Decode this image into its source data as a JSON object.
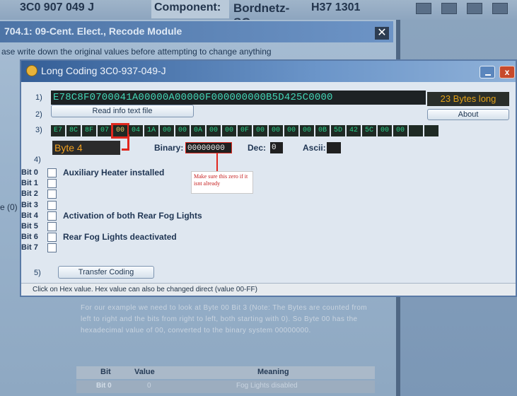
{
  "background": {
    "top_cells": [
      "3C0 907 049 J",
      "Component:",
      "Bordnetz-SG",
      "H37 1301"
    ],
    "title": "704.1: 09-Cent. Elect., Recode Module",
    "hint": "ase write down the original values before attempting to change anything",
    "side_fragment": "e (0)",
    "paragraph": "For our example we need to look at Byte 00 Bit 3 (Note: The Bytes are counted from left to right and the bits from right to left, both starting with 0). So Byte 00 has the hexadecimal value of 00, converted to the binary system 00000000.",
    "table": {
      "headers": [
        "Bit",
        "Value",
        "Meaning"
      ],
      "rows": [
        [
          "Bit 0",
          "0",
          "Fog Lights disabled"
        ]
      ]
    }
  },
  "dialog": {
    "title": "Long Coding 3C0-937-049-J",
    "row_labels": [
      "1)",
      "2)",
      "3)",
      "4)",
      "5)"
    ],
    "full_code": "E78C8F0700041A00000A00000F000000000B5D425C0000",
    "bytes_long": "23 Bytes long",
    "read_info_button": "Read info text file",
    "about_button": "About",
    "hex_bytes": [
      "E7",
      "8C",
      "8F",
      "07",
      "00",
      "04",
      "1A",
      "00",
      "00",
      "0A",
      "00",
      "00",
      "0F",
      "00",
      "00",
      "00",
      "00",
      "0B",
      "5D",
      "42",
      "5C",
      "00",
      "00"
    ],
    "selected_byte_index": 4,
    "byte_label": "Byte 4",
    "binary_label": "Binary:",
    "binary_value": "00000000",
    "dec_label": "Dec:",
    "dec_value": "0",
    "ascii_label": "Ascii:",
    "ascii_value": "",
    "note": "Make sure this zero if it isnt already",
    "bits": [
      {
        "name": "Bit 0",
        "desc": "Auxiliary Heater installed"
      },
      {
        "name": "Bit 1",
        "desc": ""
      },
      {
        "name": "Bit 2",
        "desc": ""
      },
      {
        "name": "Bit 3",
        "desc": ""
      },
      {
        "name": "Bit 4",
        "desc": "Activation of both Rear Fog Lights"
      },
      {
        "name": "Bit 5",
        "desc": ""
      },
      {
        "name": "Bit 6",
        "desc": "Rear Fog Lights deactivated"
      },
      {
        "name": "Bit 7",
        "desc": ""
      }
    ],
    "transfer_button": "Transfer Coding",
    "status": "Click on Hex value. Hex value can also be changed direct (value 00-FF)"
  }
}
